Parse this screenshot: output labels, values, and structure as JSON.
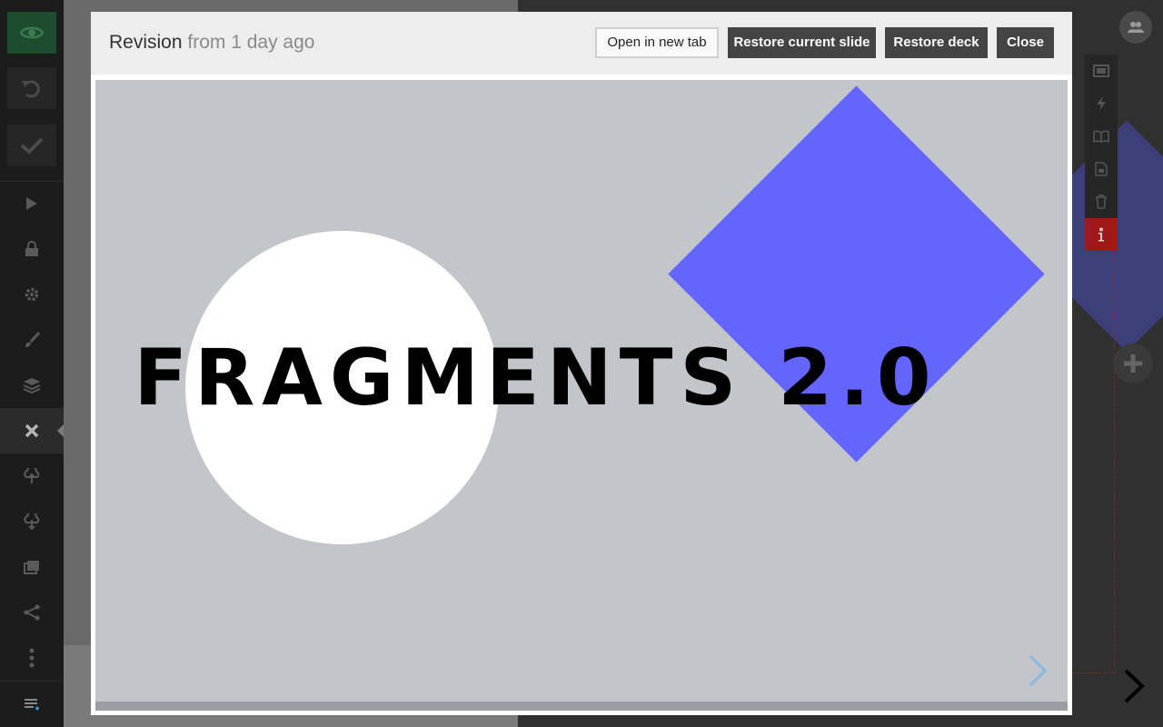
{
  "modal": {
    "title": "Revision",
    "subtitle": "from 1 day ago",
    "buttons": {
      "open_new_tab": "Open in new tab",
      "restore_slide": "Restore current slide",
      "restore_deck": "Restore deck",
      "close": "Close"
    }
  },
  "slide": {
    "title": "FRAGMENTS 2.0",
    "colors": {
      "background": "#c2c6ca",
      "circle": "#ffffff",
      "diamond": "#6464ff"
    }
  },
  "sidebar": {
    "icons": [
      "eye-icon",
      "undo-icon",
      "check-icon",
      "play-icon",
      "lock-icon",
      "gear-icon",
      "brush-icon",
      "layers-icon",
      "close-icon",
      "cloud-upload-icon",
      "cloud-download-icon",
      "image-icon",
      "share-icon",
      "more-icon",
      "menu-icon"
    ]
  },
  "slide_toolbar": {
    "icons": [
      "slide-icon",
      "bolt-icon",
      "book-icon",
      "import-icon",
      "trash-icon",
      "info-icon"
    ]
  }
}
